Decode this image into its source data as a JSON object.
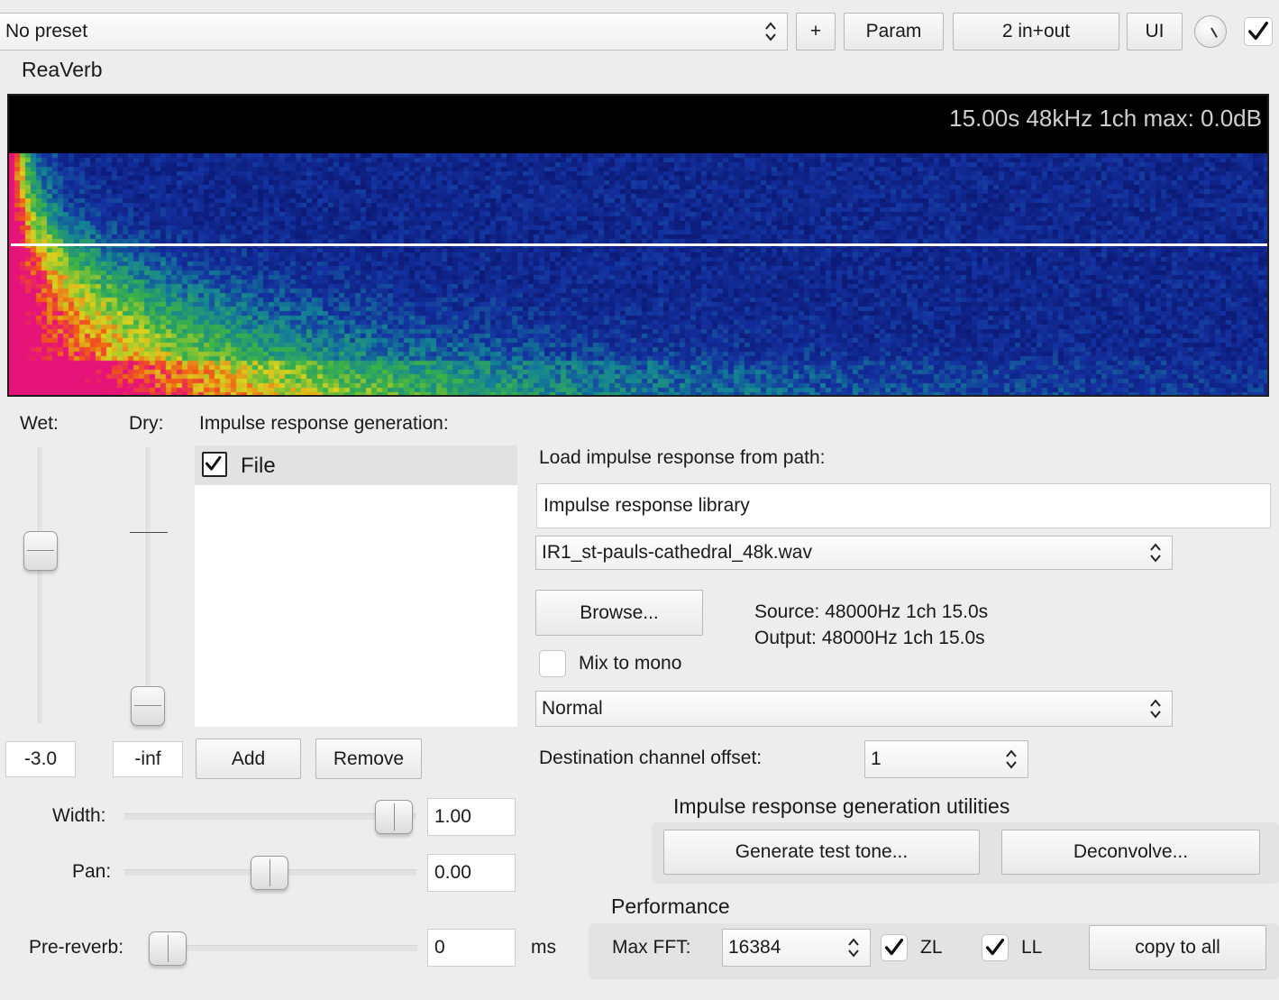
{
  "toolbar": {
    "preset_value": "No preset",
    "add_label": "+",
    "param_label": "Param",
    "io_label": "2 in+out",
    "ui_label": "UI",
    "enabled": true
  },
  "plugin_title": "ReaVerb",
  "display": {
    "info": "15.00s 48kHz 1ch max: 0.0dB"
  },
  "mix": {
    "wet_label": "Wet:",
    "dry_label": "Dry:",
    "wet_value": "-3.0",
    "dry_value": "-inf"
  },
  "ir_gen": {
    "heading": "Impulse response generation:",
    "items": [
      {
        "label": "File",
        "checked": true
      }
    ],
    "add_label": "Add",
    "remove_label": "Remove"
  },
  "params": {
    "width_label": "Width:",
    "width_value": "1.00",
    "pan_label": "Pan:",
    "pan_value": "0.00",
    "prereverb_label": "Pre-reverb:",
    "prereverb_value": "0",
    "prereverb_unit": "ms"
  },
  "file": {
    "path_label": "Load impulse response from path:",
    "path_value": "Impulse response library",
    "file_select": "IR1_st-pauls-cathedral_48k.wav",
    "browse_label": "Browse...",
    "source_info": "Source: 48000Hz 1ch 15.0s",
    "output_info": "Output: 48000Hz 1ch 15.0s",
    "mix_mono_label": "Mix to mono",
    "mix_mono_checked": false,
    "mode_select": "Normal",
    "dest_offset_label": "Destination channel offset:",
    "dest_offset_value": "1"
  },
  "utilities": {
    "heading": "Impulse response generation utilities",
    "test_tone_label": "Generate test tone...",
    "deconvolve_label": "Deconvolve..."
  },
  "performance": {
    "heading": "Performance",
    "max_fft_label": "Max FFT:",
    "max_fft_value": "16384",
    "zl_label": "ZL",
    "zl_checked": true,
    "ll_label": "LL",
    "ll_checked": true,
    "copy_label": "copy to all"
  }
}
